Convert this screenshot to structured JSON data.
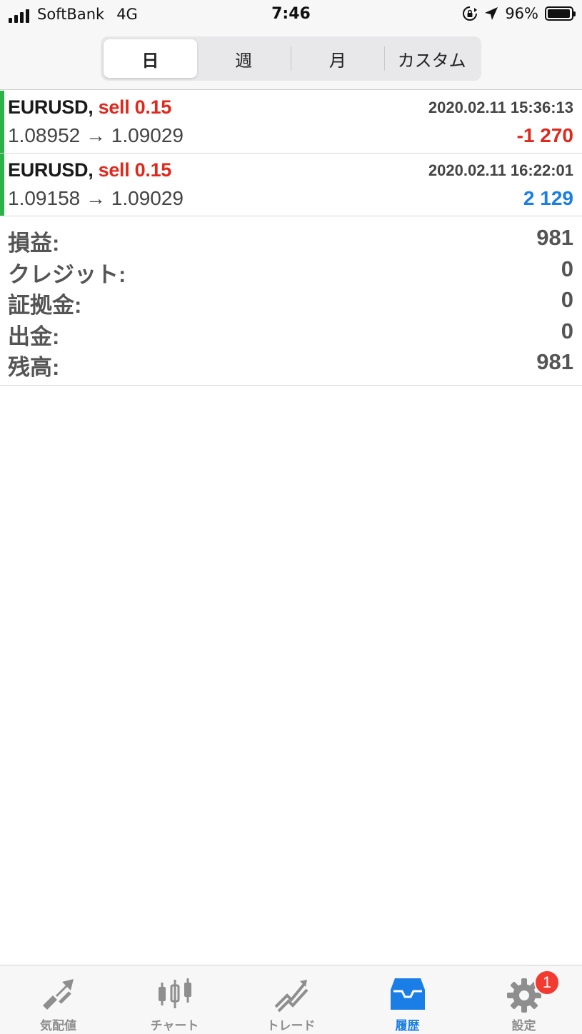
{
  "status_bar": {
    "carrier": "SoftBank",
    "network": "4G",
    "time": "7:46",
    "battery_percent": "96%",
    "battery_level": 0.96,
    "icons": [
      "signal-icon",
      "orientation-lock-icon",
      "location-icon",
      "battery-icon"
    ]
  },
  "period_tabs": {
    "items": [
      {
        "label": "日",
        "active": true
      },
      {
        "label": "週",
        "active": false
      },
      {
        "label": "月",
        "active": false
      },
      {
        "label": "カスタム",
        "active": false
      }
    ]
  },
  "trades": [
    {
      "symbol": "EURUSD,",
      "side": "sell 0.15",
      "time": "2020.02.11 15:36:13",
      "prices": "1.08952 → 1.09029",
      "profit": "-1 270"
    },
    {
      "symbol": "EURUSD,",
      "side": "sell 0.15",
      "time": "2020.02.11 16:22:01",
      "prices": "1.09158 → 1.09029",
      "profit": "2 129"
    }
  ],
  "summary": [
    {
      "label": "損益:",
      "value": "981"
    },
    {
      "label": "クレジット:",
      "value": "0"
    },
    {
      "label": "証拠金:",
      "value": "0"
    },
    {
      "label": "出金:",
      "value": "0"
    },
    {
      "label": "残高:",
      "value": "981"
    }
  ],
  "tabbar": {
    "items": [
      {
        "label": "気配値",
        "icon": "quotes-icon",
        "active": false
      },
      {
        "label": "チャート",
        "icon": "chart-candles-icon",
        "active": false
      },
      {
        "label": "トレード",
        "icon": "trade-icon",
        "active": false
      },
      {
        "label": "履歴",
        "icon": "history-inbox-icon",
        "active": true
      },
      {
        "label": "設定",
        "icon": "gear-icon",
        "active": false,
        "badge": "1"
      }
    ]
  },
  "colors": {
    "accent_blue": "#1a7ee6",
    "loss_red": "#e0281c",
    "trade_bar_green": "#2db24a",
    "badge_red": "#f23a30"
  }
}
